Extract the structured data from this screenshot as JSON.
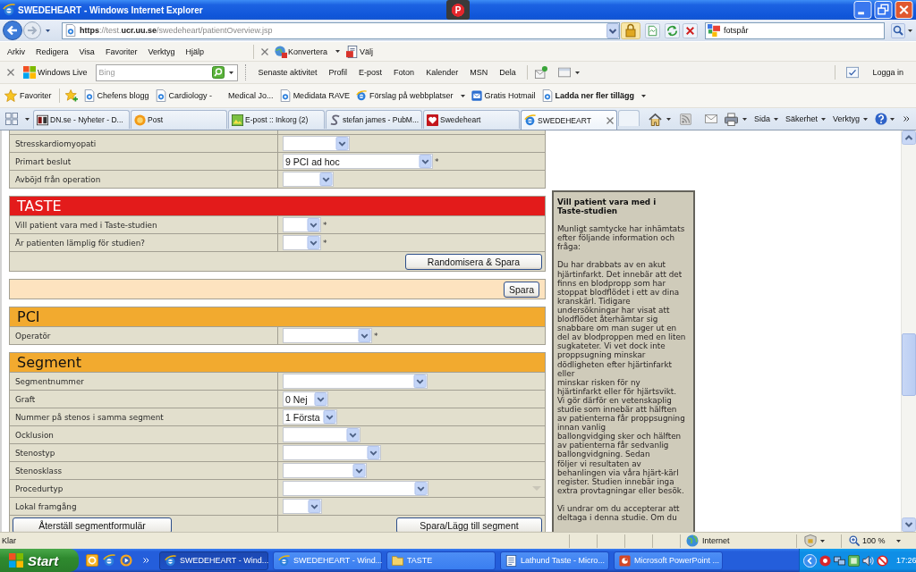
{
  "window": {
    "title": "SWEDEHEART - Windows Internet Explorer",
    "badge": "P"
  },
  "address_bar": {
    "url": "**https**://test.**ucr.uu.se**/swedeheart/patientOverview.jsp",
    "search_value": "fotspår"
  },
  "menu_bar": {
    "items": [
      "Arkiv",
      "Redigera",
      "Visa",
      "Favoriter",
      "Verktyg",
      "Hjälp"
    ],
    "addons": [
      {
        "label": "Konvertera",
        "dropdown": true
      },
      {
        "label": "Välj",
        "dropdown": false
      }
    ]
  },
  "live_toolbar": {
    "brand": "Windows Live",
    "search_placeholder": "Bing",
    "links": [
      "Senaste aktivitet",
      "Profil",
      "E-post",
      "Foton",
      "Kalender",
      "MSN",
      "Dela"
    ],
    "sign_in": "Logga in"
  },
  "favorites_bar": {
    "label": "Favoriter",
    "items": [
      {
        "label": "Chefens blogg",
        "kind": "page",
        "dropdown": false,
        "bold": false
      },
      {
        "label": "Cardiology -",
        "kind": "page",
        "dropdown": false,
        "bold": false
      },
      {
        "label": "Medical Jo...",
        "kind": "plain",
        "dropdown": false,
        "bold": false
      },
      {
        "label": "Medidata RAVE",
        "kind": "page",
        "dropdown": false,
        "bold": false
      },
      {
        "label": "Förslag på webbplatser",
        "kind": "suggested",
        "dropdown": true,
        "bold": false
      },
      {
        "label": "Gratis Hotmail",
        "kind": "hotmail",
        "dropdown": false,
        "bold": false
      },
      {
        "label": "Ladda ner fler tillägg",
        "kind": "page",
        "dropdown": true,
        "bold": true
      }
    ]
  },
  "tabs": [
    {
      "label": "DN.se - Nyheter - D...",
      "kind": "news",
      "selected": false
    },
    {
      "label": "Post",
      "kind": "post",
      "selected": false
    },
    {
      "label": "E-post :: Inkorg (2)",
      "kind": "mail",
      "selected": false
    },
    {
      "label": "stefan james - PubM...",
      "kind": "swirl",
      "selected": false
    },
    {
      "label": "Swedeheart",
      "kind": "heart",
      "selected": false
    },
    {
      "label": "SWEDEHEART",
      "kind": "browser",
      "selected": true
    }
  ],
  "command_bar": {
    "menus": [
      "Sida",
      "Säkerhet",
      "Verktyg"
    ]
  },
  "form": {
    "sections": [
      {
        "kind": "table",
        "rows": [
          {
            "kind": "field",
            "label": "Stresskardiomyopati"
          },
          {
            "kind": "field",
            "label": "Primart beslut",
            "value": "9 PCI ad hoc",
            "mark": "*"
          },
          {
            "kind": "field",
            "label": "Avböjd från operation"
          }
        ]
      },
      {
        "kind": "table",
        "header": "TASTE",
        "color": "#e31b1b",
        "rows": [
          {
            "kind": "field",
            "label": "Vill patient vara med i Taste-studien",
            "mark": "*"
          },
          {
            "kind": "field",
            "label": "Är patienten lämplig för studien?",
            "mark": "*"
          },
          {
            "kind": "actions",
            "right_button": "Randomisera & Spara"
          }
        ]
      },
      {
        "kind": "save_bar",
        "button": "Spara"
      },
      {
        "kind": "table",
        "header": "PCI",
        "color": "#f2aa2f",
        "rows": [
          {
            "kind": "field",
            "label": "Operatör",
            "mark": "*"
          }
        ]
      },
      {
        "kind": "table",
        "header": "Segment",
        "color": "#f2aa2f",
        "rows": [
          {
            "kind": "field",
            "label": "Segmentnummer"
          },
          {
            "kind": "field",
            "label": "Graft",
            "value": "0 Nej"
          },
          {
            "kind": "field",
            "label": "Nummer på stenos i samma segment",
            "value": "1 Första"
          },
          {
            "kind": "field",
            "label": "Ocklusion"
          },
          {
            "kind": "field",
            "label": "Stenostyp"
          },
          {
            "kind": "field",
            "label": "Stenosklass"
          },
          {
            "kind": "field",
            "label": "Procedurtyp",
            "faded_arrow": true
          },
          {
            "kind": "field",
            "label": "Lokal framgång"
          },
          {
            "kind": "actions",
            "left_button": "Återställ segmentformulär",
            "right_button": "Spara/Lägg till segment"
          }
        ]
      }
    ]
  },
  "info_panel": {
    "title": "Vill patient vara med i\nTaste-studien",
    "paragraphs": [
      "Munligt samtycke har inhämtats\nefter följande information och\nfråga:",
      "Du har drabbats av en akut\nhjärtinfarkt. Det innebär att det\nfinns en blodpropp som har\nstoppat blodflödet i ett av dina\nkranskärl. Tidigare\nundersökningar har visat att\nblodflödet återhämtar sig\nsnabbare om man suger ut en\ndel av blodproppen med en liten\nsugkateter. Vi vet dock inte\nproppsugning minskar\ndödligheten efter hjärtinfarkt\neller\nminskar risken för ny\nhjärtinfarkt eller för hjärtsvikt.\nVi gör därför en vetenskaplig\nstudie som innebär att hälften\nav patienterna får proppsugning\ninnan vanlig\nballongvidging sker och hälften\nav patienterna får sedvanlig\nballongvidgning. Sedan\nföljer vi resultaten av\nbehanlingen via våra hjärt-kärl\nregister. Studien innebär inga\nextra provtagningar eller besök.",
      "Vi undrar om du accepterar att\ndeltaga i denna studie. Om du"
    ]
  },
  "status_bar": {
    "status": "Klar",
    "zone": "Internet",
    "zoom": "100 %"
  },
  "taskbar": {
    "start": "Start",
    "tasks": [
      {
        "label": "SWEDEHEART - Wind...",
        "kind": "browser",
        "selected": true
      },
      {
        "label": "SWEDEHEART - Wind...",
        "kind": "browser",
        "selected": false
      },
      {
        "label": "TASTE",
        "kind": "folder",
        "selected": false
      },
      {
        "label": "Lathund Taste - Micro...",
        "kind": "document",
        "selected": false
      },
      {
        "label": "Microsoft PowerPoint ...",
        "kind": "slides",
        "selected": false
      }
    ],
    "clock": "17:26"
  }
}
